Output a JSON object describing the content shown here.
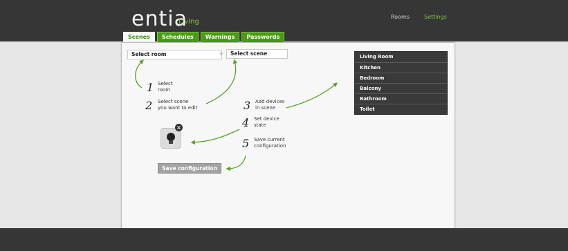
{
  "app": {
    "logo_text": "entia",
    "logo_sub": "Living",
    "nav": {
      "rooms": "Rooms",
      "settings": "Settings"
    }
  },
  "tabs": [
    {
      "label": "Scenes"
    },
    {
      "label": "Schedules"
    },
    {
      "label": "Warnings"
    },
    {
      "label": "Passwords"
    }
  ],
  "selectors": {
    "room": "Select room",
    "separator": "»",
    "scene": "Select scene"
  },
  "rooms": [
    {
      "label": "Living Room"
    },
    {
      "label": "Kitchen"
    },
    {
      "label": "Bedroom"
    },
    {
      "label": "Balcony"
    },
    {
      "label": "Bathroom"
    },
    {
      "label": "Toilet"
    }
  ],
  "steps": [
    {
      "num": "1",
      "line1": "Select",
      "line2": "room"
    },
    {
      "num": "2",
      "line1": "Select scene",
      "line2": "you want to edit"
    },
    {
      "num": "3",
      "line1": "Add devices",
      "line2": "in scene"
    },
    {
      "num": "4",
      "line1": "Set device",
      "line2": "state"
    },
    {
      "num": "5",
      "line1": "Save current",
      "line2": "configuration"
    }
  ],
  "device": {
    "icon": "lightbulb-icon",
    "close": "×"
  },
  "save_button": "Save configuration",
  "colors": {
    "accent": "#7fc241",
    "tab_green": "#4a9a16",
    "arrow": "#5aa12a",
    "dark": "#363636"
  }
}
